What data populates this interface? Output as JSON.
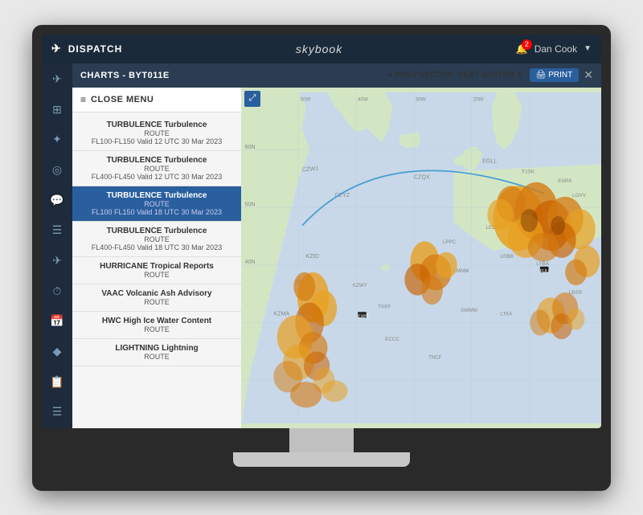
{
  "app": {
    "title": "DISPATCH",
    "logo": "skybook",
    "user": "Dan Cook",
    "notification_count": "2",
    "tab_title": "CHARTS - BYT011E"
  },
  "top_nav": {
    "prev_label": "◄ PREV SECTOR",
    "next_label": "NEXT SECTOR ►",
    "print_label": "🖨 PRINT",
    "close_x": "✕"
  },
  "menu": {
    "close_label": "CLOSE MENU",
    "items": [
      {
        "title": "ROUTE",
        "sub1": "FL100-FL150 Valid 12 UTC 30 Mar 2023",
        "sub2": "",
        "active": false,
        "type": "TURBULENCE Turbulence"
      },
      {
        "title": "TURBULENCE Turbulence",
        "sub1": "ROUTE",
        "sub2": "FL400-FL450 Valid 12 UTC 30 Mar 2023",
        "active": false,
        "type": ""
      },
      {
        "title": "TURBULENCE Turbulence",
        "sub1": "ROUTE",
        "sub2": "FL100 FL150 Valid 18 UTC 30 Mar 2023",
        "active": true,
        "type": ""
      },
      {
        "title": "TURBULENCE Turbulence",
        "sub1": "ROUTE",
        "sub2": "FL400-FL450 Valid 18 UTC 30 Mar 2023",
        "active": false,
        "type": ""
      },
      {
        "title": "HURRICANE Tropical Reports",
        "sub1": "ROUTE",
        "sub2": "",
        "active": false,
        "type": ""
      },
      {
        "title": "VAAC Volcanic Ash Advisory",
        "sub1": "ROUTE",
        "sub2": "",
        "active": false,
        "type": ""
      },
      {
        "title": "HWC High Ice Water Content",
        "sub1": "ROUTE",
        "sub2": "",
        "active": false,
        "type": ""
      },
      {
        "title": "LIGHTNING Lightning",
        "sub1": "ROUTE",
        "sub2": "",
        "active": false,
        "type": ""
      }
    ]
  },
  "sidebar": {
    "icons": [
      "✈",
      "⊞",
      "✦",
      "⚙",
      "💬",
      "☰",
      "✈",
      "⏱",
      "🗓",
      "✦",
      "📋",
      "☰"
    ]
  },
  "colors": {
    "accent_blue": "#2a5f9e",
    "header_dark": "#1a2a3a",
    "sidebar_dark": "#1e2b3c",
    "panel_bg": "#f5f5f5",
    "active_item": "#2a5f9e"
  }
}
